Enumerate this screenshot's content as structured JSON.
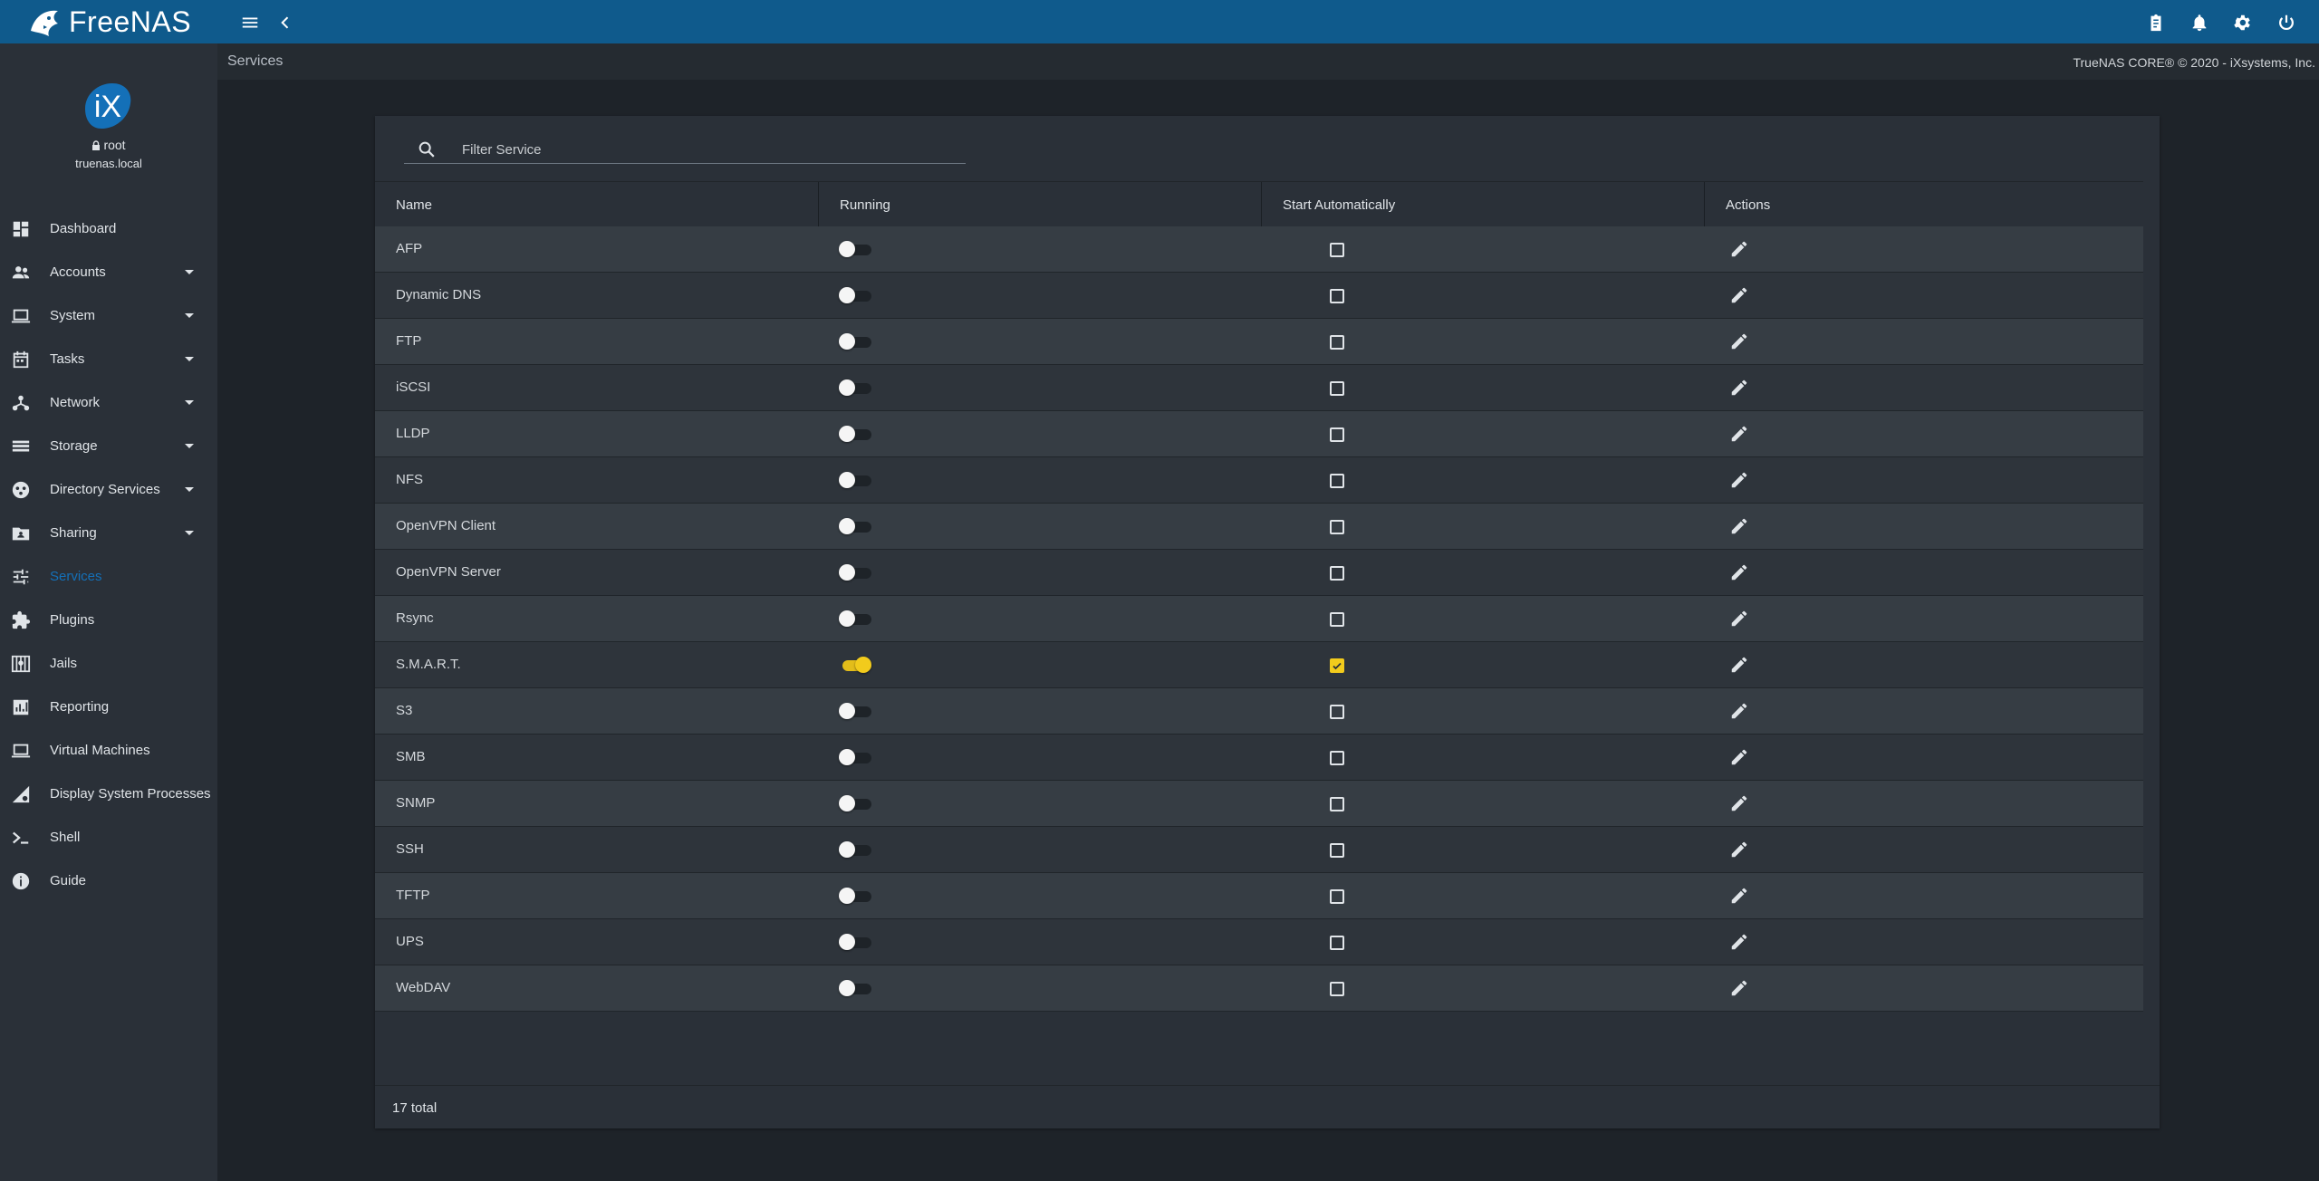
{
  "app": {
    "logo_text": "FreeNAS",
    "accent": "#0f5a8c",
    "active_color": "#1470b8",
    "toggle_on_color": "#f2cb1c"
  },
  "user": {
    "name": "root",
    "host": "truenas.local"
  },
  "header": {
    "breadcrumb": "Services",
    "copyright": "TrueNAS CORE® © 2020 - iXsystems, Inc."
  },
  "sidebar": {
    "items": [
      {
        "label": "Dashboard",
        "icon": "dashboard-icon",
        "has_submenu": false,
        "active": false
      },
      {
        "label": "Accounts",
        "icon": "accounts-icon",
        "has_submenu": true,
        "active": false
      },
      {
        "label": "System",
        "icon": "system-icon",
        "has_submenu": true,
        "active": false
      },
      {
        "label": "Tasks",
        "icon": "tasks-icon",
        "has_submenu": true,
        "active": false
      },
      {
        "label": "Network",
        "icon": "network-icon",
        "has_submenu": true,
        "active": false
      },
      {
        "label": "Storage",
        "icon": "storage-icon",
        "has_submenu": true,
        "active": false
      },
      {
        "label": "Directory Services",
        "icon": "directory-services-icon",
        "has_submenu": true,
        "active": false
      },
      {
        "label": "Sharing",
        "icon": "sharing-icon",
        "has_submenu": true,
        "active": false
      },
      {
        "label": "Services",
        "icon": "services-icon",
        "has_submenu": false,
        "active": true
      },
      {
        "label": "Plugins",
        "icon": "plugins-icon",
        "has_submenu": false,
        "active": false
      },
      {
        "label": "Jails",
        "icon": "jails-icon",
        "has_submenu": false,
        "active": false
      },
      {
        "label": "Reporting",
        "icon": "reporting-icon",
        "has_submenu": false,
        "active": false
      },
      {
        "label": "Virtual Machines",
        "icon": "virtual-machines-icon",
        "has_submenu": false,
        "active": false
      },
      {
        "label": "Display System Processes",
        "icon": "system-processes-icon",
        "has_submenu": false,
        "active": false
      },
      {
        "label": "Shell",
        "icon": "shell-icon",
        "has_submenu": false,
        "active": false
      },
      {
        "label": "Guide",
        "icon": "guide-icon",
        "has_submenu": false,
        "active": false
      }
    ]
  },
  "services": {
    "filter_placeholder": "Filter Service",
    "columns": [
      "Name",
      "Running",
      "Start Automatically",
      "Actions"
    ],
    "rows": [
      {
        "name": "AFP",
        "running": false,
        "start_automatically": false
      },
      {
        "name": "Dynamic DNS",
        "running": false,
        "start_automatically": false
      },
      {
        "name": "FTP",
        "running": false,
        "start_automatically": false
      },
      {
        "name": "iSCSI",
        "running": false,
        "start_automatically": false
      },
      {
        "name": "LLDP",
        "running": false,
        "start_automatically": false
      },
      {
        "name": "NFS",
        "running": false,
        "start_automatically": false
      },
      {
        "name": "OpenVPN Client",
        "running": false,
        "start_automatically": false
      },
      {
        "name": "OpenVPN Server",
        "running": false,
        "start_automatically": false
      },
      {
        "name": "Rsync",
        "running": false,
        "start_automatically": false
      },
      {
        "name": "S.M.A.R.T.",
        "running": true,
        "start_automatically": true
      },
      {
        "name": "S3",
        "running": false,
        "start_automatically": false
      },
      {
        "name": "SMB",
        "running": false,
        "start_automatically": false
      },
      {
        "name": "SNMP",
        "running": false,
        "start_automatically": false
      },
      {
        "name": "SSH",
        "running": false,
        "start_automatically": false
      },
      {
        "name": "TFTP",
        "running": false,
        "start_automatically": false
      },
      {
        "name": "UPS",
        "running": false,
        "start_automatically": false
      },
      {
        "name": "WebDAV",
        "running": false,
        "start_automatically": false
      }
    ],
    "total_label": "17 total"
  }
}
